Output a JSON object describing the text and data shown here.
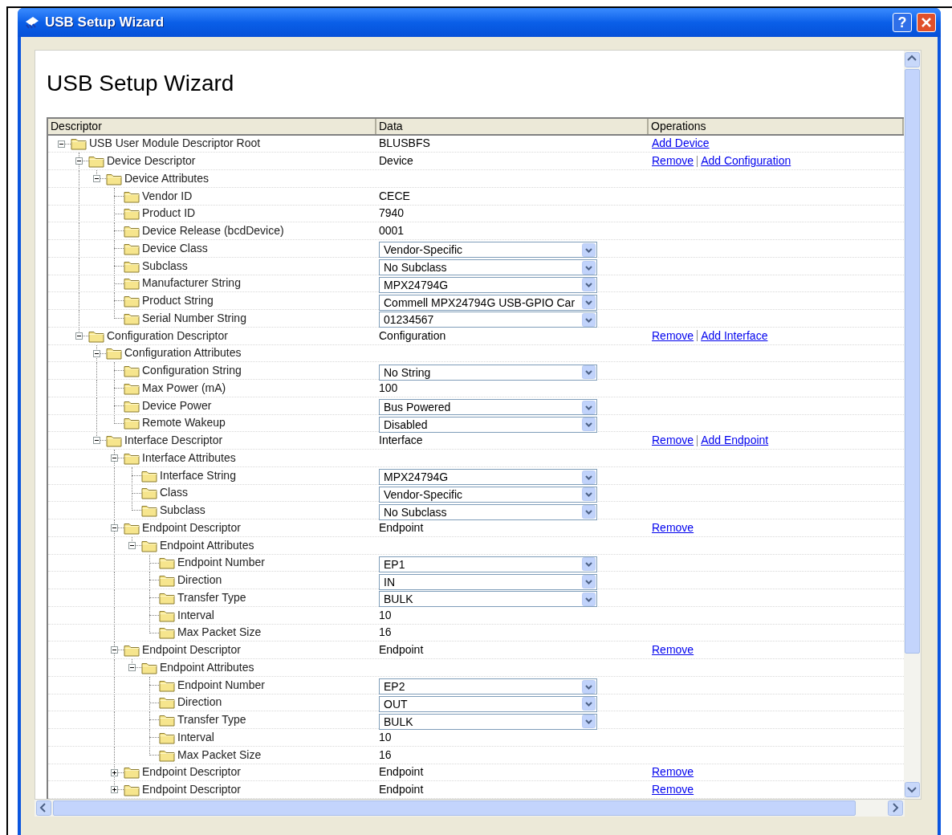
{
  "window": {
    "title": "USB Setup Wizard",
    "help_label": "?"
  },
  "heading": "USB Setup Wizard",
  "table": {
    "columns": [
      "Descriptor",
      "Data",
      "Operations"
    ],
    "tree": [
      {
        "label": "USB User Module Descriptor Root",
        "data": "BLUSBFS",
        "kind": "text",
        "operations": [
          "Add Device"
        ],
        "expanded": true,
        "children": [
          {
            "label": "Device Descriptor",
            "data": "Device",
            "kind": "text",
            "operations": [
              "Remove",
              "Add Configuration"
            ],
            "expanded": true,
            "children": [
              {
                "label": "Device Attributes",
                "expanded": true,
                "children": [
                  {
                    "label": "Vendor ID",
                    "data": "CECE",
                    "kind": "text"
                  },
                  {
                    "label": "Product ID",
                    "data": "7940",
                    "kind": "text"
                  },
                  {
                    "label": "Device Release (bcdDevice)",
                    "data": "0001",
                    "kind": "text"
                  },
                  {
                    "label": "Device Class",
                    "data": "Vendor-Specific",
                    "kind": "select"
                  },
                  {
                    "label": "Subclass",
                    "data": "No Subclass",
                    "kind": "select"
                  },
                  {
                    "label": "Manufacturer String",
                    "data": "MPX24794G",
                    "kind": "select"
                  },
                  {
                    "label": "Product String",
                    "data": "Commell MPX24794G USB-GPIO Car",
                    "kind": "select"
                  },
                  {
                    "label": "Serial Number String",
                    "data": "01234567",
                    "kind": "select"
                  }
                ]
              }
            ]
          },
          {
            "label": "Configuration Descriptor",
            "data": "Configuration",
            "kind": "text",
            "operations": [
              "Remove",
              "Add Interface"
            ],
            "expanded": true,
            "children": [
              {
                "label": "Configuration Attributes",
                "expanded": true,
                "children": [
                  {
                    "label": "Configuration String",
                    "data": "No String",
                    "kind": "select"
                  },
                  {
                    "label": "Max Power (mA)",
                    "data": "100",
                    "kind": "text"
                  },
                  {
                    "label": "Device Power",
                    "data": "Bus Powered",
                    "kind": "select"
                  },
                  {
                    "label": "Remote Wakeup",
                    "data": "Disabled",
                    "kind": "select"
                  }
                ]
              },
              {
                "label": "Interface Descriptor",
                "data": "Interface",
                "kind": "text",
                "operations": [
                  "Remove",
                  "Add Endpoint"
                ],
                "expanded": true,
                "children": [
                  {
                    "label": "Interface Attributes",
                    "expanded": true,
                    "children": [
                      {
                        "label": "Interface String",
                        "data": "MPX24794G",
                        "kind": "select"
                      },
                      {
                        "label": "Class",
                        "data": "Vendor-Specific",
                        "kind": "select"
                      },
                      {
                        "label": "Subclass",
                        "data": "No Subclass",
                        "kind": "select"
                      }
                    ]
                  },
                  {
                    "label": "Endpoint Descriptor",
                    "data": "Endpoint",
                    "kind": "text",
                    "operations": [
                      "Remove"
                    ],
                    "expanded": true,
                    "children": [
                      {
                        "label": "Endpoint Attributes",
                        "expanded": true,
                        "children": [
                          {
                            "label": "Endpoint Number",
                            "data": "EP1",
                            "kind": "select"
                          },
                          {
                            "label": "Direction",
                            "data": "IN",
                            "kind": "select"
                          },
                          {
                            "label": "Transfer Type",
                            "data": "BULK",
                            "kind": "select"
                          },
                          {
                            "label": "Interval",
                            "data": "10",
                            "kind": "text"
                          },
                          {
                            "label": "Max Packet Size",
                            "data": "16",
                            "kind": "text"
                          }
                        ]
                      }
                    ]
                  },
                  {
                    "label": "Endpoint Descriptor",
                    "data": "Endpoint",
                    "kind": "text",
                    "operations": [
                      "Remove"
                    ],
                    "expanded": true,
                    "children": [
                      {
                        "label": "Endpoint Attributes",
                        "expanded": true,
                        "children": [
                          {
                            "label": "Endpoint Number",
                            "data": "EP2",
                            "kind": "select"
                          },
                          {
                            "label": "Direction",
                            "data": "OUT",
                            "kind": "select"
                          },
                          {
                            "label": "Transfer Type",
                            "data": "BULK",
                            "kind": "select"
                          },
                          {
                            "label": "Interval",
                            "data": "10",
                            "kind": "text"
                          },
                          {
                            "label": "Max Packet Size",
                            "data": "16",
                            "kind": "text"
                          }
                        ]
                      }
                    ]
                  },
                  {
                    "label": "Endpoint Descriptor",
                    "data": "Endpoint",
                    "kind": "text",
                    "operations": [
                      "Remove"
                    ],
                    "expanded": false
                  },
                  {
                    "label": "Endpoint Descriptor",
                    "data": "Endpoint",
                    "kind": "text",
                    "operations": [
                      "Remove"
                    ],
                    "expanded": false
                  }
                ]
              }
            ]
          }
        ]
      }
    ]
  }
}
